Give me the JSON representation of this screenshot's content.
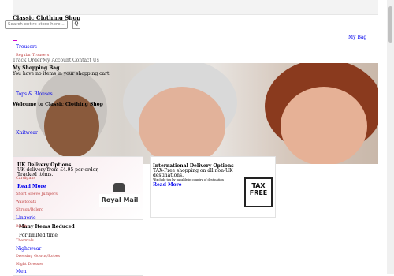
{
  "header": {
    "logo": "Classic Clothing Shop",
    "search_placeholder": "Search entire store here...",
    "search_button": "Q",
    "bag_link": "My Bag",
    "menu_icon": "hamburger-icon"
  },
  "nav": {
    "trousers": "Trousers",
    "regular_trousers": "Regular Trousers",
    "track_order": "Track Order",
    "my_account": "My Account",
    "contact_us": "Contact Us",
    "shopping_bag_title": "My Shopping Bag",
    "bag_empty": "You have no items in your shopping cart.",
    "tops_blouses": "Tops & Blouses",
    "welcome": "Welcome to Classic Clothing Shop",
    "knitwear": "Knitwear",
    "cardigans": "Cardigans",
    "short_sleeve_jumpers": "Short Sleeve Jumpers",
    "waistcoats": "Waistcoats",
    "shrugs_bolero": "Shrugs/Bolero",
    "lingerie": "Lingerie",
    "briefs": "Briefs",
    "thermals": "Thermals",
    "nightwear": "Nightwear",
    "dressing_gowns": "Dressing Gowns/Robes",
    "night_dresses": "Night Dresses",
    "men": "Men"
  },
  "promos": {
    "uk_title": "UK Delivery Options",
    "uk_line1": "UK delivery from £4.95 per order,",
    "uk_line2": "Tracked items.",
    "uk_read_more": "Read More",
    "uk_logo": "Royal Mail",
    "int_title": "International Delivery Options",
    "int_line1": "TAX-Free shopping on all non-UK",
    "int_line2": "destinations.",
    "int_note": "*Exclude tax by payable in country of destination",
    "int_read_more": "Read More",
    "int_logo_top": "TAX",
    "int_logo_bottom": "FREE",
    "red_title": "Many Items Reduced",
    "red_line1": "For limited time"
  },
  "colors": {
    "link": "#0000ee",
    "accent": "#cc00cc"
  }
}
